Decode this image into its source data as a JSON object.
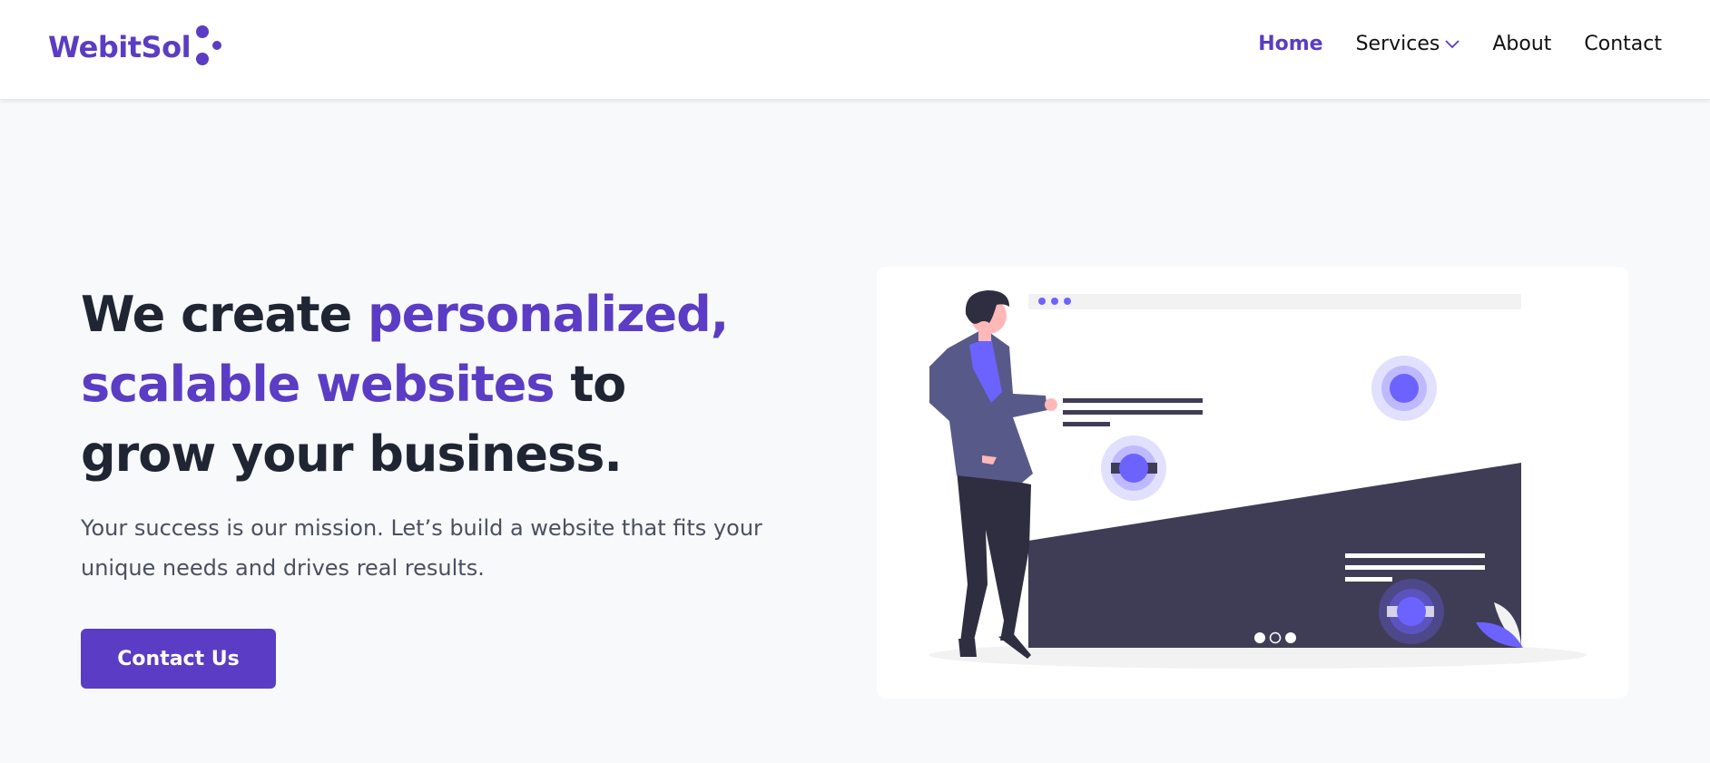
{
  "brand": {
    "name": "WebitSol",
    "color": "#5b3cc4"
  },
  "nav": {
    "items": [
      {
        "label": "Home",
        "active": true
      },
      {
        "label": "Services",
        "has_dropdown": true
      },
      {
        "label": "About"
      },
      {
        "label": "Contact"
      }
    ],
    "dropdown_icon": "chevron-down-icon"
  },
  "hero": {
    "title_part1": "We create ",
    "title_accent": "personalized, scalable websites",
    "title_part2": " to grow your business.",
    "subtitle": "Your success is our mission. Let’s build a website that fits your unique needs and drives real results.",
    "cta_label": "Contact Us"
  },
  "illustration": {
    "description_icon": "presenter-with-website-mockup-illustration",
    "colors": {
      "primary": "#6c63ff",
      "dark": "#3f3d56",
      "light": "#f2f2f2"
    }
  }
}
